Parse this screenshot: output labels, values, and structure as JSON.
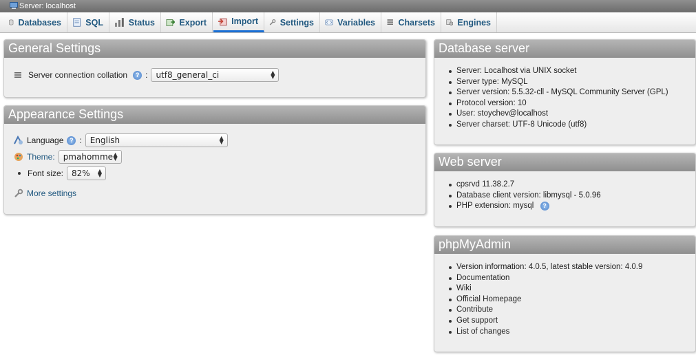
{
  "server_bar": {
    "title": "Server: localhost"
  },
  "tabs": [
    {
      "label": "Databases",
      "icon": "database-icon"
    },
    {
      "label": "SQL",
      "icon": "sql-icon"
    },
    {
      "label": "Status",
      "icon": "status-icon"
    },
    {
      "label": "Export",
      "icon": "export-icon"
    },
    {
      "label": "Import",
      "icon": "import-icon",
      "active": true
    },
    {
      "label": "Settings",
      "icon": "wrench-icon"
    },
    {
      "label": "Variables",
      "icon": "variables-icon"
    },
    {
      "label": "Charsets",
      "icon": "charsets-icon"
    },
    {
      "label": "Engines",
      "icon": "engines-icon"
    }
  ],
  "general_settings": {
    "title": "General Settings",
    "collation_label": "Server connection collation",
    "collation_value": "utf8_general_ci"
  },
  "appearance_settings": {
    "title": "Appearance Settings",
    "language_label": "Language",
    "language_value": "English",
    "theme_label": "Theme:",
    "theme_value": "pmahomme",
    "font_size_label": "Font size:",
    "font_size_value": "82%",
    "more_settings": "More settings"
  },
  "database_server": {
    "title": "Database server",
    "items": [
      "Server: Localhost via UNIX socket",
      "Server type: MySQL",
      "Server version: 5.5.32-cll - MySQL Community Server (GPL)",
      "Protocol version: 10",
      "User: stoychev@localhost",
      "Server charset: UTF-8 Unicode (utf8)"
    ]
  },
  "web_server": {
    "title": "Web server",
    "items": [
      "cpsrvd 11.38.2.7",
      "Database client version: libmysql - 5.0.96",
      "PHP extension: mysql"
    ]
  },
  "phpmyadmin": {
    "title": "phpMyAdmin",
    "version_info": "Version information: 4.0.5, latest stable version: 4.0.9",
    "links": [
      "Documentation",
      "Wiki",
      "Official Homepage",
      "Contribute",
      "Get support",
      "List of changes"
    ]
  },
  "colors": {
    "link": "#235a81",
    "active_tab_underline": "#1a6fd4",
    "panel_header": "#9f9f9f"
  }
}
